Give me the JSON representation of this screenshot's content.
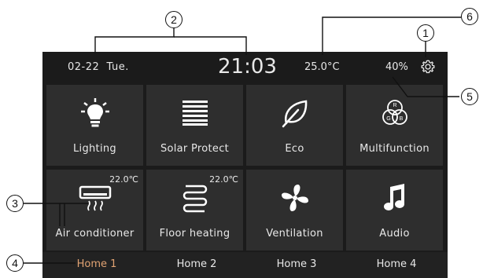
{
  "status": {
    "date": "02-22",
    "weekday": "Tue.",
    "time": "21:03",
    "temperature": "25.0°C",
    "humidity": "40%"
  },
  "tiles": [
    {
      "label": "Lighting",
      "icon": "bulb-icon"
    },
    {
      "label": "Solar Protect",
      "icon": "blinds-icon"
    },
    {
      "label": "Eco",
      "icon": "leaf-icon"
    },
    {
      "label": "Multifunction",
      "icon": "rgb-icon"
    },
    {
      "label": "Air conditioner",
      "icon": "ac-icon",
      "setpoint": "22.0℃"
    },
    {
      "label": "Floor heating",
      "icon": "floor-heating-icon",
      "setpoint": "22.0℃"
    },
    {
      "label": "Ventilation",
      "icon": "fan-icon"
    },
    {
      "label": "Audio",
      "icon": "music-note-icon"
    }
  ],
  "rgb_letters": [
    "R",
    "G",
    "B"
  ],
  "tabs": [
    {
      "label": "Home 1",
      "active": true
    },
    {
      "label": "Home 2",
      "active": false
    },
    {
      "label": "Home 3",
      "active": false
    },
    {
      "label": "Home 4",
      "active": false
    }
  ],
  "callouts": [
    "1",
    "2",
    "3",
    "4",
    "5",
    "6"
  ],
  "colors": {
    "panel": "#1b1b1b",
    "tile": "#2e2e2e",
    "active_tab": "#e1a373",
    "text": "#e8e8e8"
  }
}
